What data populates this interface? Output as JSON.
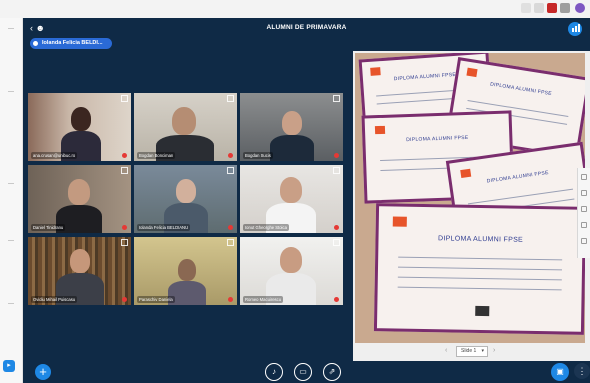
{
  "app": {
    "title": "ALUMNI DE PRIMAVARA",
    "presenter_chip": "Iolanda Felicia BELDI..."
  },
  "participants": [
    {
      "name": "ana.crusan@unibuc.ro"
    },
    {
      "name": "Bogdan Bonciman"
    },
    {
      "name": "Bogdan Sucis"
    },
    {
      "name": "Daniel Tinidranu"
    },
    {
      "name": "Iolanda Felicia BELDIANU"
    },
    {
      "name": "Ionut Gheorghe Stoica"
    },
    {
      "name": "Ovidiu Mihail Puiscasu"
    },
    {
      "name": "Paraschiv Daniela"
    },
    {
      "name": "Romeo Macuirescu"
    }
  ],
  "slide": {
    "diplomas": [
      {
        "title": "DIPLOMA ALUMNI FPSE"
      },
      {
        "title": "DIPLOMA ALUMNI FPSE"
      },
      {
        "title": "DIPLOMA ALUMNI FPSE"
      },
      {
        "title": "DIPLOMA ALUMNI FPSE"
      },
      {
        "title": "DIPLOMA ALUMNI FPSE"
      }
    ],
    "page_select": "Slide 1"
  },
  "icons": {
    "users": "users-icon",
    "stats": "connection-status-icon",
    "plus": "plus-icon",
    "audio": "audio-icon",
    "video": "video-icon",
    "share": "screen-share-icon",
    "options": "options-icon"
  },
  "colors": {
    "app_bg": "#0f2a46",
    "accent": "#1e88e5",
    "chip": "#2a6ad6",
    "diploma_border": "#7a2d6e"
  }
}
